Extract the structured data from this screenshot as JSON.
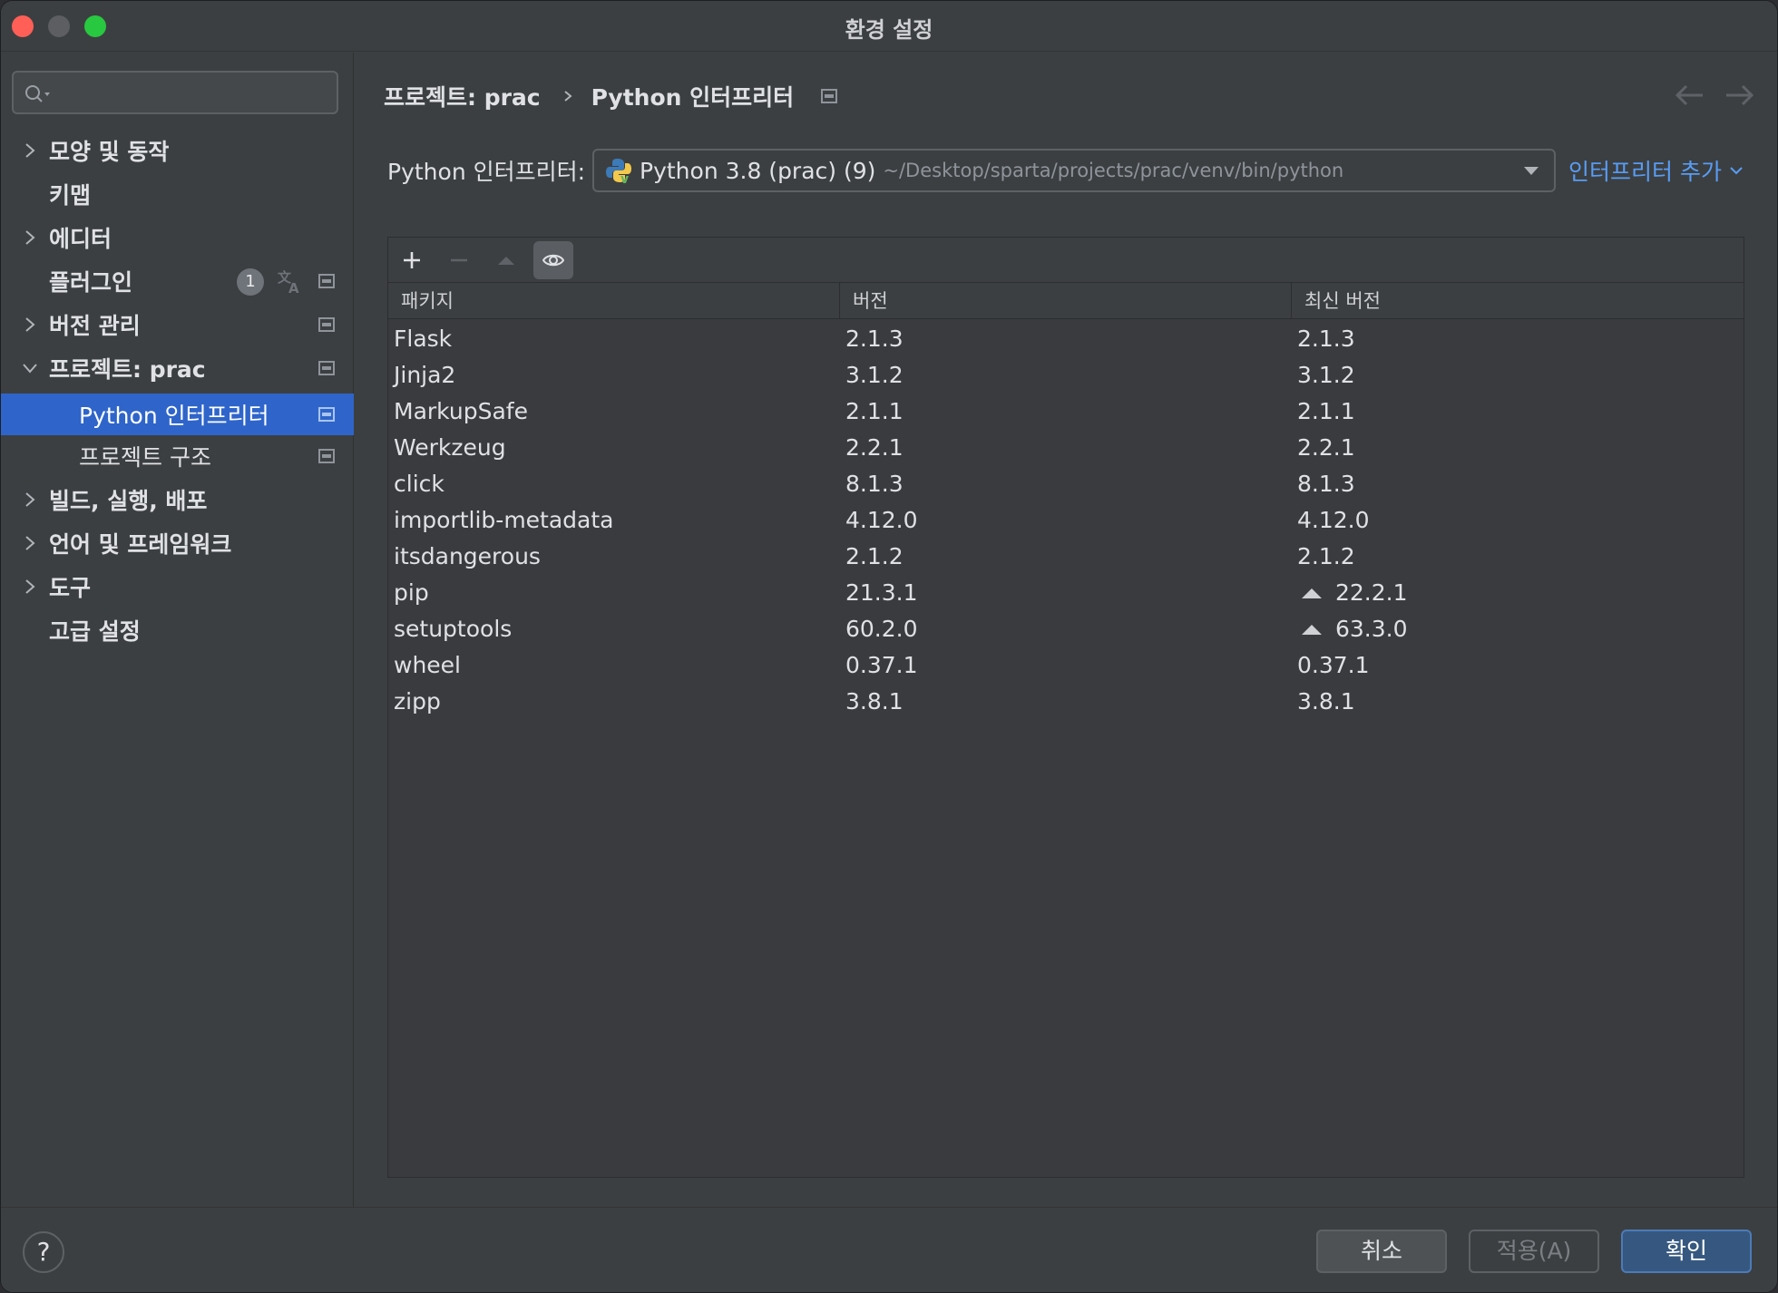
{
  "window": {
    "title": "환경 설정"
  },
  "search": {
    "placeholder": ""
  },
  "sidebar": {
    "items": [
      {
        "label": "모양 및 동작"
      },
      {
        "label": "키맵"
      },
      {
        "label": "에디터"
      },
      {
        "label": "플러그인",
        "badge": "1"
      },
      {
        "label": "버전 관리"
      },
      {
        "label": "프로젝트: prac"
      },
      {
        "label": "Python 인터프리터"
      },
      {
        "label": "프로젝트 구조"
      },
      {
        "label": "빌드, 실행, 배포"
      },
      {
        "label": "언어 및 프레임워크"
      },
      {
        "label": "도구"
      },
      {
        "label": "고급 설정"
      }
    ]
  },
  "breadcrumb": {
    "parent": "프로젝트: prac",
    "current": "Python 인터프리터"
  },
  "interpreter": {
    "label": "Python 인터프리터:",
    "name": "Python 3.8 (prac) (9)",
    "path": "~/Desktop/sparta/projects/prac/venv/bin/python",
    "add_label": "인터프리터 추가"
  },
  "table": {
    "columns": [
      "패키지",
      "버전",
      "최신 버전"
    ],
    "rows": [
      {
        "package": "Flask",
        "version": "2.1.3",
        "latest": "2.1.3",
        "upgrade": false
      },
      {
        "package": "Jinja2",
        "version": "3.1.2",
        "latest": "3.1.2",
        "upgrade": false
      },
      {
        "package": "MarkupSafe",
        "version": "2.1.1",
        "latest": "2.1.1",
        "upgrade": false
      },
      {
        "package": "Werkzeug",
        "version": "2.2.1",
        "latest": "2.2.1",
        "upgrade": false
      },
      {
        "package": "click",
        "version": "8.1.3",
        "latest": "8.1.3",
        "upgrade": false
      },
      {
        "package": "importlib-metadata",
        "version": "4.12.0",
        "latest": "4.12.0",
        "upgrade": false
      },
      {
        "package": "itsdangerous",
        "version": "2.1.2",
        "latest": "2.1.2",
        "upgrade": false
      },
      {
        "package": "pip",
        "version": "21.3.1",
        "latest": "22.2.1",
        "upgrade": true
      },
      {
        "package": "setuptools",
        "version": "60.2.0",
        "latest": "63.3.0",
        "upgrade": true
      },
      {
        "package": "wheel",
        "version": "0.37.1",
        "latest": "0.37.1",
        "upgrade": false
      },
      {
        "package": "zipp",
        "version": "3.8.1",
        "latest": "3.8.1",
        "upgrade": false
      }
    ]
  },
  "footer": {
    "help_label": "?",
    "cancel_label": "취소",
    "apply_label": "적용(A)",
    "ok_label": "확인"
  },
  "colors": {
    "accent": "#2f65ca",
    "link": "#589df6",
    "background": "#3c3f41"
  }
}
